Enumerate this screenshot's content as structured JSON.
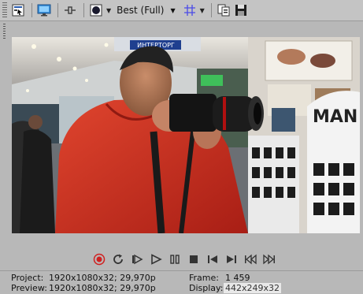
{
  "toolbar": {
    "quality_label": "Best (Full)",
    "icons": [
      "video-properties-icon",
      "external-monitor-icon",
      "split-screen-icon",
      "preview-quality-icon",
      "overlays-grid-icon",
      "copy-snapshot-icon",
      "save-snapshot-icon"
    ]
  },
  "preview": {
    "sign_text": "MAN",
    "store_text": "ИНТЕРТОРГ"
  },
  "transport": {
    "buttons": [
      "record",
      "loop",
      "play-from-start",
      "play",
      "pause",
      "stop",
      "previous-frame",
      "next-frame",
      "previous",
      "next"
    ]
  },
  "info": {
    "project_label": "Project:",
    "project_value": "1920x1080x32; 29,970p",
    "preview_label": "Preview:",
    "preview_value": "1920x1080x32; 29,970p",
    "frame_label": "Frame:",
    "frame_value": "1 459",
    "display_label": "Display:",
    "display_value": "442x249x32"
  },
  "colors": {
    "toolbar_bg": "#c4c4c4",
    "body_bg": "#b8b8b8",
    "record_red": "#d02020"
  }
}
